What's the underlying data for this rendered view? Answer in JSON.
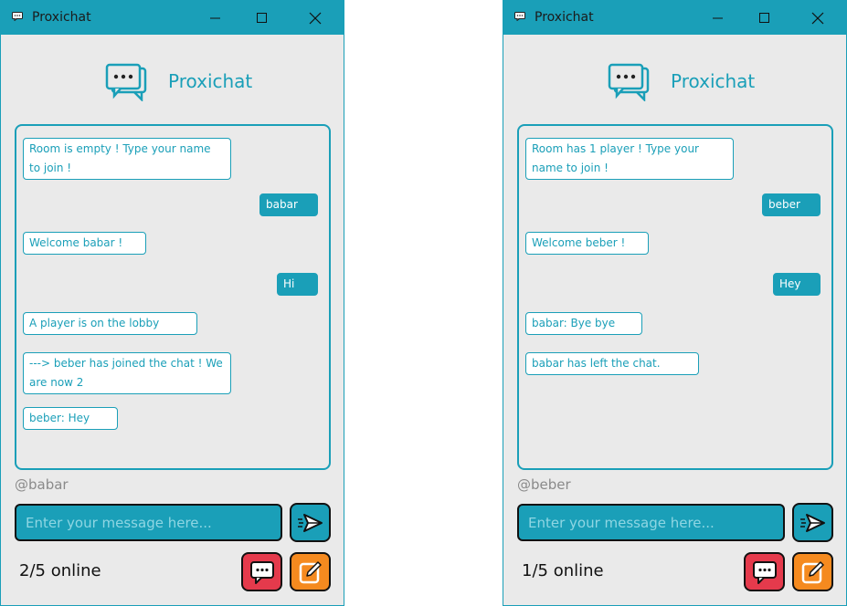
{
  "colors": {
    "accent": "#1a9fb8",
    "chat_button": "#e53a4c",
    "edit_button": "#f58a1f"
  },
  "windows": [
    {
      "title": "Proxichat",
      "logo_text": "Proxichat",
      "messages": [
        {
          "text": "Room is empty ! Type your name to join !",
          "side": "recv"
        },
        {
          "text": "babar",
          "side": "sent"
        },
        {
          "text": "Welcome babar !",
          "side": "recv"
        },
        {
          "text": "Hi",
          "side": "sent"
        },
        {
          "text": "A player is on the lobby",
          "side": "recv"
        },
        {
          "text": "---> beber has joined the chat ! We are now 2",
          "side": "recv"
        },
        {
          "text": "beber: Hey",
          "side": "recv"
        }
      ],
      "username": "@babar",
      "input_placeholder": "Enter your message here...",
      "online": "2/5 online"
    },
    {
      "title": "Proxichat",
      "logo_text": "Proxichat",
      "messages": [
        {
          "text": "Room has 1 player ! Type your name to join !",
          "side": "recv"
        },
        {
          "text": "beber",
          "side": "sent"
        },
        {
          "text": "Welcome beber !",
          "side": "recv"
        },
        {
          "text": "Hey",
          "side": "sent"
        },
        {
          "text": "babar: Bye bye",
          "side": "recv"
        },
        {
          "text": "babar has left the chat.",
          "side": "recv"
        }
      ],
      "username": "@beber",
      "input_placeholder": "Enter your message here...",
      "online": "1/5 online"
    }
  ],
  "icons": {
    "window_icon": "chat-bubble-icon",
    "minimize": "minimize-icon",
    "maximize": "maximize-icon",
    "close": "close-icon",
    "logo": "chat-bubbles-logo-icon",
    "send": "paper-plane-icon",
    "chat": "chat-bubble-icon",
    "edit": "pencil-edit-icon"
  }
}
